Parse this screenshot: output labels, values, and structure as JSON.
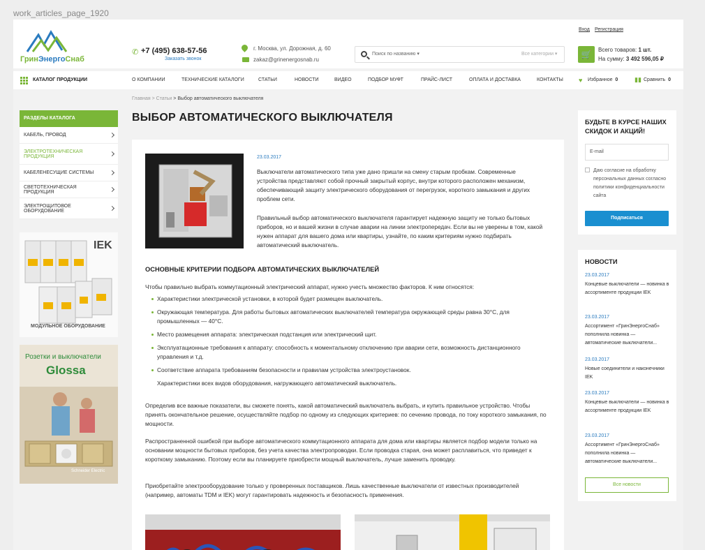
{
  "frame_label": "work_articles_page_1920",
  "header": {
    "logo_text_1": "Грин",
    "logo_text_2": "Энерго",
    "logo_text_3": "Снаб",
    "phone": "+7 (495) 638-57-56",
    "callback": "Заказать звонок",
    "address": "г. Москва, ул. Дорожная, д. 60",
    "email": "zakaz@grinenergosnab.ru",
    "search_placeholder": "Поиск по названию ▾",
    "search_category": "Все категории ▾",
    "login": "Вход",
    "register": "Регистрация",
    "cart_count_label": "Всего товаров: ",
    "cart_count": "1 шт.",
    "cart_sum_label": "На сумму: ",
    "cart_sum": "3 492 596,05 ₽"
  },
  "nav": {
    "catalog": "КАТАЛОГ ПРОДУКЦИИ",
    "items": [
      "О КОМПАНИИ",
      "ТЕХНИЧЕСКИЕ КАТАЛОГИ",
      "СТАТЬИ",
      "НОВОСТИ",
      "ВИДЕО",
      "ПОДБОР МУФТ",
      "ПРАЙС-ЛИСТ",
      "ОПЛАТА И ДОСТАВКА",
      "КОНТАКТЫ"
    ],
    "favorites": "Избранное",
    "favorites_count": "0",
    "compare": "Сравнить",
    "compare_count": "0"
  },
  "breadcrumb": {
    "home": "Главная",
    "sep": ">",
    "articles": "Статьи",
    "current": "> Выбор автоматического выключателя"
  },
  "page_title": "ВЫБОР АВТОМАТИЧЕСКОГО ВЫКЛЮЧАТЕЛЯ",
  "sidebar": {
    "title": "РАЗДЕЛЫ КАТАЛОГА",
    "items": [
      {
        "label": "КАБЕЛЬ, ПРОВОД"
      },
      {
        "label": "ЭЛЕКТРОТЕХНИЧЕСКАЯ ПРОДУКЦИЯ"
      },
      {
        "label": "КАБЕЛЕНЕСУЩИЕ СИСТЕМЫ"
      },
      {
        "label": "СВЕТОТЕХНИЧЕСКАЯ ПРОДУКЦИЯ"
      },
      {
        "label": "ЭЛЕКТРОЩИТОВОЕ ОБОРУДОВАНИЕ"
      }
    ],
    "banner1_brand": "IEK",
    "banner1_caption": "МОДУЛЬНОЕ ОБОРУДОВАНИЕ",
    "banner2_line1": "Розетки и выключатели",
    "banner2_line2": "Glossa",
    "banner2_brand": "Schneider Electric"
  },
  "article": {
    "date": "23.03.2017",
    "p1": "Выключатели автоматического типа уже дано пришли на смену старым пробкам. Современные устройства представляют собой прочный закрытый корпус, внутри которого расположен механизм, обеспечивающий защиту электрического оборудования от перегрузок, короткого замыкания и других проблем сети.",
    "p2": "Правильный выбор автоматического выключателя гарантирует надежную защиту не только бытовых приборов, но и вашей жизни в случае аварии на линии электропередач. Если вы не уверены в том, какой нужен аппарат для вашего дома или квартиры, узнайте, по каким критериям нужно подбирать автоматический выключатель.",
    "h2": "ОСНОВНЫЕ КРИТЕРИИ ПОДБОРА АВТОМАТИЧЕСКИХ ВЫКЛЮЧАТЕЛЕЙ",
    "intro": "Чтобы правильно выбрать коммутационный электрический аппарат, нужно учесть множество факторов. К ним относятся:",
    "bullets": [
      "Характеристики электрической установки, в которой будет размещен выключатель.",
      "Окружающая температура. Для работы бытовых автоматических выключателей температура окружающей среды равна 30°С, для промышленных — 40°С.",
      "Место размещения аппарата: электрическая подстанция или электрический щит.",
      "Эксплуатационные требования к аппарату: способность к моментальному отключению при аварии сети, возможность дистанционного управления и т.д.",
      "Соответствие аппарата требованиям безопасности и правилам устройства электроустановок.",
      "Характеристики всех видов оборудования, нагружающего автоматический выключатель."
    ],
    "p3": "Определив все важные показатели, вы сможете понять, какой автоматический выключатель выбрать, и купить правильное устройство. Чтобы принять окончательное решение, осуществляйте подбор по одному из следующих критериев: по сечению провода, по току короткого замыкания, по мощности.",
    "p4": "Распространенной ошибкой при выборе автоматического коммутационного аппарата для дома или квартиры является подбор модели только на основании мощности бытовых приборов, без учета качества электропроводки. Если проводка старая, она может расплавиться, что приведет к короткому замыканию. Поэтому если вы планируете приобрести мощный выключатель, лучше заменить проводку.",
    "p5": "Приобретайте электрооборудование только у проверенных поставщиков. Лишь качественные выключатели от известных производителей (например, автоматы TDM и IEK) могут гарантировать надежность и безопасность применения."
  },
  "subscribe": {
    "title": "БУДЬТЕ В КУРСЕ НАШИХ СКИДОК И АКЦИЙ!",
    "email_placeholder": "E-mail",
    "consent": "Даю согласие на обработку персональных данных согласно политики конфиденциальности сайта",
    "button": "Подписаться"
  },
  "news": {
    "title": "НОВОСТИ",
    "items": [
      {
        "date": "23.03.2017",
        "text": "Концевые выключатели — новинка в ассортименте продукции IEK"
      },
      {
        "date": "23.03.2017",
        "text": "Ассортимент «ГринЭнергоСнаб» пополнила новинка — автоматические выключатели..."
      },
      {
        "date": "23.03.2017",
        "text": "Новые соединители и наконечники IEK"
      },
      {
        "date": "23.03.2017",
        "text": "Концевые выключатели — новинка в ассортименте продукции IEK"
      },
      {
        "date": "23.03.2017",
        "text": "Ассортимент «ГринЭнергоСнаб» пополнила новинка — автоматические выключатели..."
      }
    ],
    "all_button": "Все новости"
  },
  "colors": {
    "accent_green": "#7ab638",
    "link_blue": "#2a7bbf",
    "button_blue": "#1a8fd0"
  }
}
